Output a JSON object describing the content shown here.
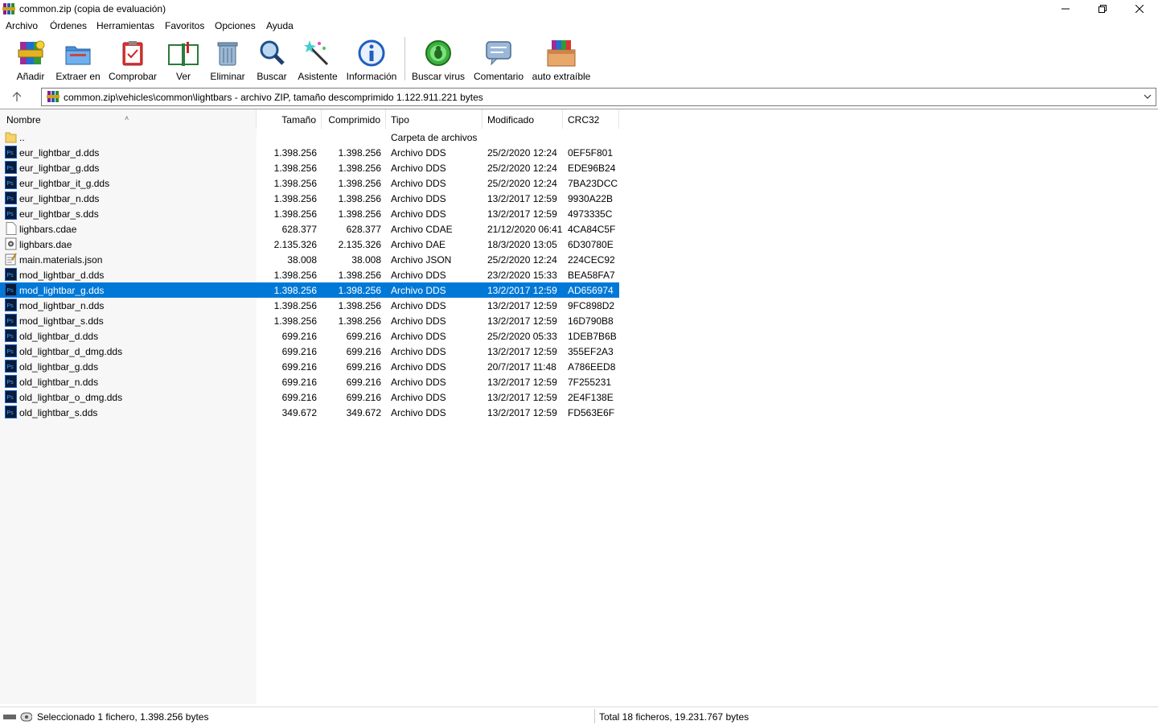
{
  "window": {
    "title": "common.zip (copia de evaluación)"
  },
  "menu": [
    "Archivo",
    "Órdenes",
    "Herramientas",
    "Favoritos",
    "Opciones",
    "Ayuda"
  ],
  "toolbar": [
    {
      "label": "Añadir",
      "icon": "add-archive-icon"
    },
    {
      "label": "Extraer en",
      "icon": "extract-folder-icon"
    },
    {
      "label": "Comprobar",
      "icon": "test-clipboard-icon"
    },
    {
      "label": "Ver",
      "icon": "view-book-icon"
    },
    {
      "label": "Eliminar",
      "icon": "trash-icon"
    },
    {
      "label": "Buscar",
      "icon": "magnifier-icon"
    },
    {
      "label": "Asistente",
      "icon": "wizard-wand-icon"
    },
    {
      "label": "Información",
      "icon": "info-icon"
    },
    {
      "label": "Buscar virus",
      "icon": "virus-scan-icon"
    },
    {
      "label": "Comentario",
      "icon": "comment-icon"
    },
    {
      "label": "auto extraíble",
      "icon": "sfx-box-icon"
    }
  ],
  "path": {
    "text": "common.zip\\vehicles\\common\\lightbars - archivo ZIP, tamaño descomprimido 1.122.911.221 bytes"
  },
  "columns": {
    "name": "Nombre",
    "size": "Tamaño",
    "packed": "Comprimido",
    "type": "Tipo",
    "modified": "Modificado",
    "crc": "CRC32"
  },
  "files": [
    {
      "name": "..",
      "size": "",
      "packed": "",
      "type": "Carpeta de archivos",
      "modified": "",
      "crc": "",
      "icon": "folder-icon",
      "selected": false
    },
    {
      "name": "eur_lightbar_d.dds",
      "size": "1.398.256",
      "packed": "1.398.256",
      "type": "Archivo DDS",
      "modified": "25/2/2020 12:24",
      "crc": "0EF5F801",
      "icon": "photoshop-file-icon",
      "selected": false
    },
    {
      "name": "eur_lightbar_g.dds",
      "size": "1.398.256",
      "packed": "1.398.256",
      "type": "Archivo DDS",
      "modified": "25/2/2020 12:24",
      "crc": "EDE96B24",
      "icon": "photoshop-file-icon",
      "selected": false
    },
    {
      "name": "eur_lightbar_it_g.dds",
      "size": "1.398.256",
      "packed": "1.398.256",
      "type": "Archivo DDS",
      "modified": "25/2/2020 12:24",
      "crc": "7BA23DCC",
      "icon": "photoshop-file-icon",
      "selected": false
    },
    {
      "name": "eur_lightbar_n.dds",
      "size": "1.398.256",
      "packed": "1.398.256",
      "type": "Archivo DDS",
      "modified": "13/2/2017 12:59",
      "crc": "9930A22B",
      "icon": "photoshop-file-icon",
      "selected": false
    },
    {
      "name": "eur_lightbar_s.dds",
      "size": "1.398.256",
      "packed": "1.398.256",
      "type": "Archivo DDS",
      "modified": "13/2/2017 12:59",
      "crc": "4973335C",
      "icon": "photoshop-file-icon",
      "selected": false
    },
    {
      "name": "lighbars.cdae",
      "size": "628.377",
      "packed": "628.377",
      "type": "Archivo CDAE",
      "modified": "21/12/2020 06:41",
      "crc": "4CA84C5F",
      "icon": "blank-file-icon",
      "selected": false
    },
    {
      "name": "lighbars.dae",
      "size": "2.135.326",
      "packed": "2.135.326",
      "type": "Archivo DAE",
      "modified": "18/3/2020 13:05",
      "crc": "6D30780E",
      "icon": "dae-file-icon",
      "selected": false
    },
    {
      "name": "main.materials.json",
      "size": "38.008",
      "packed": "38.008",
      "type": "Archivo JSON",
      "modified": "25/2/2020 12:24",
      "crc": "224CEC92",
      "icon": "json-file-icon",
      "selected": false
    },
    {
      "name": "mod_lightbar_d.dds",
      "size": "1.398.256",
      "packed": "1.398.256",
      "type": "Archivo DDS",
      "modified": "23/2/2020 15:33",
      "crc": "BEA58FA7",
      "icon": "photoshop-file-icon",
      "selected": false
    },
    {
      "name": "mod_lightbar_g.dds",
      "size": "1.398.256",
      "packed": "1.398.256",
      "type": "Archivo DDS",
      "modified": "13/2/2017 12:59",
      "crc": "AD656974",
      "icon": "photoshop-file-icon",
      "selected": true
    },
    {
      "name": "mod_lightbar_n.dds",
      "size": "1.398.256",
      "packed": "1.398.256",
      "type": "Archivo DDS",
      "modified": "13/2/2017 12:59",
      "crc": "9FC898D2",
      "icon": "photoshop-file-icon",
      "selected": false
    },
    {
      "name": "mod_lightbar_s.dds",
      "size": "1.398.256",
      "packed": "1.398.256",
      "type": "Archivo DDS",
      "modified": "13/2/2017 12:59",
      "crc": "16D790B8",
      "icon": "photoshop-file-icon",
      "selected": false
    },
    {
      "name": "old_lightbar_d.dds",
      "size": "699.216",
      "packed": "699.216",
      "type": "Archivo DDS",
      "modified": "25/2/2020 05:33",
      "crc": "1DEB7B6B",
      "icon": "photoshop-file-icon",
      "selected": false
    },
    {
      "name": "old_lightbar_d_dmg.dds",
      "size": "699.216",
      "packed": "699.216",
      "type": "Archivo DDS",
      "modified": "13/2/2017 12:59",
      "crc": "355EF2A3",
      "icon": "photoshop-file-icon",
      "selected": false
    },
    {
      "name": "old_lightbar_g.dds",
      "size": "699.216",
      "packed": "699.216",
      "type": "Archivo DDS",
      "modified": "20/7/2017 11:48",
      "crc": "A786EED8",
      "icon": "photoshop-file-icon",
      "selected": false
    },
    {
      "name": "old_lightbar_n.dds",
      "size": "699.216",
      "packed": "699.216",
      "type": "Archivo DDS",
      "modified": "13/2/2017 12:59",
      "crc": "7F255231",
      "icon": "photoshop-file-icon",
      "selected": false
    },
    {
      "name": "old_lightbar_o_dmg.dds",
      "size": "699.216",
      "packed": "699.216",
      "type": "Archivo DDS",
      "modified": "13/2/2017 12:59",
      "crc": "2E4F138E",
      "icon": "photoshop-file-icon",
      "selected": false
    },
    {
      "name": "old_lightbar_s.dds",
      "size": "349.672",
      "packed": "349.672",
      "type": "Archivo DDS",
      "modified": "13/2/2017 12:59",
      "crc": "FD563E6F",
      "icon": "photoshop-file-icon",
      "selected": false
    }
  ],
  "status": {
    "left": "Seleccionado 1 fichero, 1.398.256 bytes",
    "right": "Total 18 ficheros, 19.231.767 bytes"
  },
  "colors": {
    "selection": "#0078d7",
    "name_column_bg": "#f7f7f7"
  }
}
